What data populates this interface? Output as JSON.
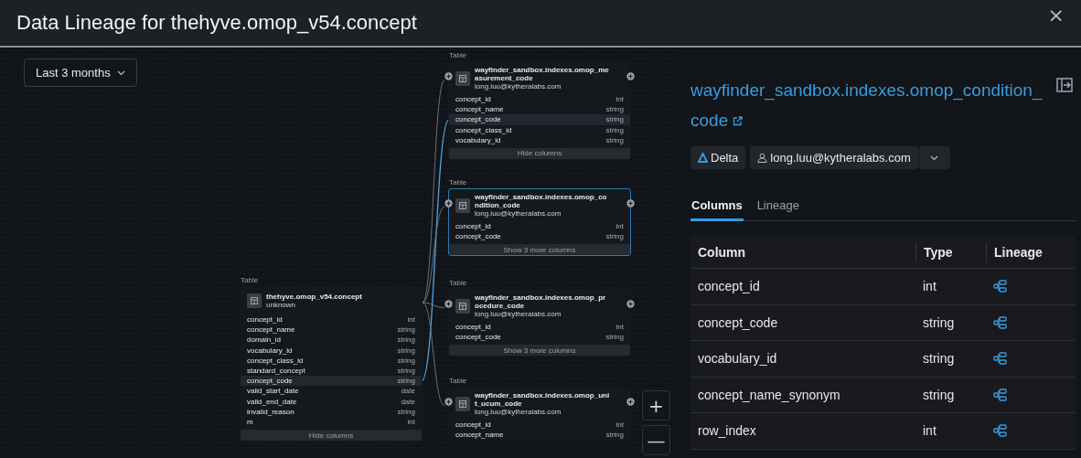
{
  "window": {
    "title": "Data Lineage for thehyve.omop_v54.concept",
    "close": "×"
  },
  "canvas": {
    "time_range": "Last 3 months",
    "source_node": {
      "label": "Table",
      "name": "thehyve.omop_v54.concept",
      "subtitle": "unknown",
      "selected": false,
      "toggle": "Hide columns",
      "columns": [
        {
          "name": "concept_id",
          "type": "int",
          "highlighted": false
        },
        {
          "name": "concept_name",
          "type": "string",
          "highlighted": false
        },
        {
          "name": "domain_id",
          "type": "string",
          "highlighted": false
        },
        {
          "name": "vocabulary_id",
          "type": "string",
          "highlighted": false
        },
        {
          "name": "concept_class_id",
          "type": "string",
          "highlighted": false
        },
        {
          "name": "standard_concept",
          "type": "string",
          "highlighted": false
        },
        {
          "name": "concept_code",
          "type": "string",
          "highlighted": true
        },
        {
          "name": "valid_start_date",
          "type": "date",
          "highlighted": false
        },
        {
          "name": "valid_end_date",
          "type": "date",
          "highlighted": false
        },
        {
          "name": "invalid_reason",
          "type": "string",
          "highlighted": false
        },
        {
          "name": "m",
          "type": "int",
          "highlighted": false
        }
      ]
    },
    "target_nodes": [
      {
        "label": "Table",
        "name": "wayfinder_sandbox.indexes.omop_measurement_code",
        "subtitle": "long.luu@kytheralabs.com",
        "selected": false,
        "toggle": "Hide columns",
        "columns": [
          {
            "name": "concept_id",
            "type": "int",
            "highlighted": false
          },
          {
            "name": "concept_name",
            "type": "string",
            "highlighted": false
          },
          {
            "name": "concept_code",
            "type": "string",
            "highlighted": true
          },
          {
            "name": "concept_class_id",
            "type": "string",
            "highlighted": false
          },
          {
            "name": "vocabulary_id",
            "type": "string",
            "highlighted": false
          }
        ]
      },
      {
        "label": "Table",
        "name": "wayfinder_sandbox.indexes.omop_condition_code",
        "subtitle": "long.luu@kytheralabs.com",
        "selected": true,
        "toggle": "Show 3 more columns",
        "columns": [
          {
            "name": "concept_id",
            "type": "int",
            "highlighted": false
          },
          {
            "name": "concept_code",
            "type": "string",
            "highlighted": false
          }
        ]
      },
      {
        "label": "Table",
        "name": "wayfinder_sandbox.indexes.omop_procedure_code",
        "subtitle": "long.luu@kytheralabs.com",
        "selected": false,
        "toggle": "Show 3 more columns",
        "columns": [
          {
            "name": "concept_id",
            "type": "int",
            "highlighted": false
          },
          {
            "name": "concept_code",
            "type": "string",
            "highlighted": false
          }
        ]
      },
      {
        "label": "Table",
        "name": "wayfinder_sandbox.indexes.omop_unit_ucum_code",
        "subtitle": "long.luu@kytheralabs.com",
        "selected": false,
        "columns": [
          {
            "name": "concept_id",
            "type": "int",
            "highlighted": false
          },
          {
            "name": "concept_name",
            "type": "string",
            "highlighted": false
          }
        ]
      }
    ],
    "zoom_buttons": [
      "+",
      "—"
    ]
  },
  "details": {
    "title": "wayfinder_sandbox.indexes.omop_condition_code",
    "tags": [
      {
        "kind": "format",
        "text": "Delta"
      },
      {
        "kind": "owner",
        "text": "long.luu@kytheralabs.com"
      }
    ],
    "tabs": [
      {
        "label": "Columns",
        "selected": true
      },
      {
        "label": "Lineage",
        "selected": false
      }
    ],
    "table": {
      "columns": [
        "Column",
        "Type",
        "Lineage"
      ],
      "rows": [
        {
          "name": "concept_id",
          "type": "int"
        },
        {
          "name": "concept_code",
          "type": "string"
        },
        {
          "name": "vocabulary_id",
          "type": "string"
        },
        {
          "name": "concept_name_synonym",
          "type": "string"
        },
        {
          "name": "row_index",
          "type": "int"
        }
      ]
    }
  }
}
